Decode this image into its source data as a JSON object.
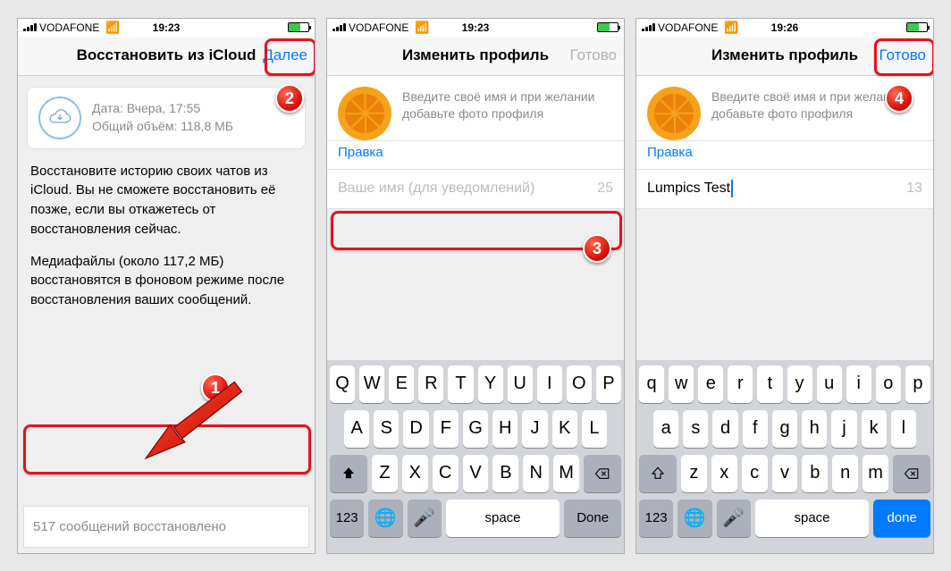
{
  "screen1": {
    "carrier": "VODAFONE",
    "time": "19:23",
    "nav_title": "Восстановить из iCloud",
    "nav_action": "Далее",
    "backup_date_label": "Дата: Вчера, 17:55",
    "backup_size_label": "Общий объём: 118,8 МБ",
    "text1": "Восстановите историю своих чатов из iCloud. Вы не сможете восстановить её позже, если вы откажетесь от восстановления сейчас.",
    "text2": "Медиафайлы (около 117,2 МБ) восстановятся в фоновом режиме после восстановления ваших сообщений.",
    "status": "517 сообщений восстановлено"
  },
  "screen2": {
    "carrier": "VODAFONE",
    "time": "19:23",
    "nav_title": "Изменить профиль",
    "nav_action": "Готово",
    "hint": "Введите своё имя и при желании добавьте фото профиля",
    "edit": "Правка",
    "name_placeholder": "Ваше имя (для уведомлений)",
    "name_value": "",
    "chars": "25"
  },
  "screen3": {
    "carrier": "VODAFONE",
    "time": "19:26",
    "nav_title": "Изменить профиль",
    "nav_action": "Готово",
    "hint": "Введите своё имя и при желании добавьте фото профиля",
    "edit": "Правка",
    "name_value": "Lumpics Test",
    "chars": "13"
  },
  "keys": {
    "r1": [
      "Q",
      "W",
      "E",
      "R",
      "T",
      "Y",
      "U",
      "I",
      "O",
      "P"
    ],
    "r2": [
      "A",
      "S",
      "D",
      "F",
      "G",
      "H",
      "J",
      "K",
      "L"
    ],
    "r3": [
      "Z",
      "X",
      "C",
      "V",
      "B",
      "N",
      "M"
    ],
    "k123": "123",
    "space": "space",
    "done": "Done"
  },
  "badges": {
    "b1": "1",
    "b2": "2",
    "b3": "3",
    "b4": "4"
  }
}
